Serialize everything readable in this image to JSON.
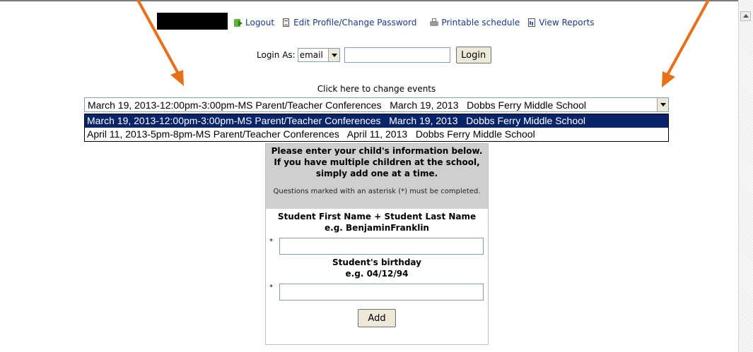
{
  "nav": {
    "logout": "Logout",
    "edit_profile": "Edit Profile/Change Password",
    "printable_schedule": "Printable schedule",
    "view_reports": "View Reports"
  },
  "login": {
    "label": "Login As:",
    "type_value": "email",
    "input_value": "",
    "button": "Login"
  },
  "events": {
    "change_label": "Click here to change events",
    "selected": "March 19, 2013-12:00pm-3:00pm-MS Parent/Teacher Conferences   March 19, 2013   Dobbs Ferry Middle School",
    "options": [
      "March 19, 2013-12:00pm-3:00pm-MS Parent/Teacher Conferences   March 19, 2013   Dobbs Ferry Middle School",
      "April 11, 2013-5pm-8pm-MS Parent/Teacher Conferences   April 11, 2013   Dobbs Ferry Middle School"
    ]
  },
  "form": {
    "instructions": [
      "Please enter your child's information below.",
      "If you have multiple children at the school,",
      "simply add one at a time."
    ],
    "note": "Questions marked with an asterisk (*) must be completed.",
    "fields": [
      {
        "label": "Student First Name + Student Last Name",
        "example": "e.g. BenjaminFranklin",
        "required_mark": "*",
        "value": ""
      },
      {
        "label": "Student's birthday",
        "example": "e.g. 04/12/94",
        "required_mark": "*",
        "value": ""
      }
    ],
    "add_button": "Add"
  },
  "colors": {
    "link": "#1a3a8a",
    "highlight": "#0a246a",
    "header_bg": "#cfcfcf",
    "annotation_arrow": "#e8701a"
  }
}
